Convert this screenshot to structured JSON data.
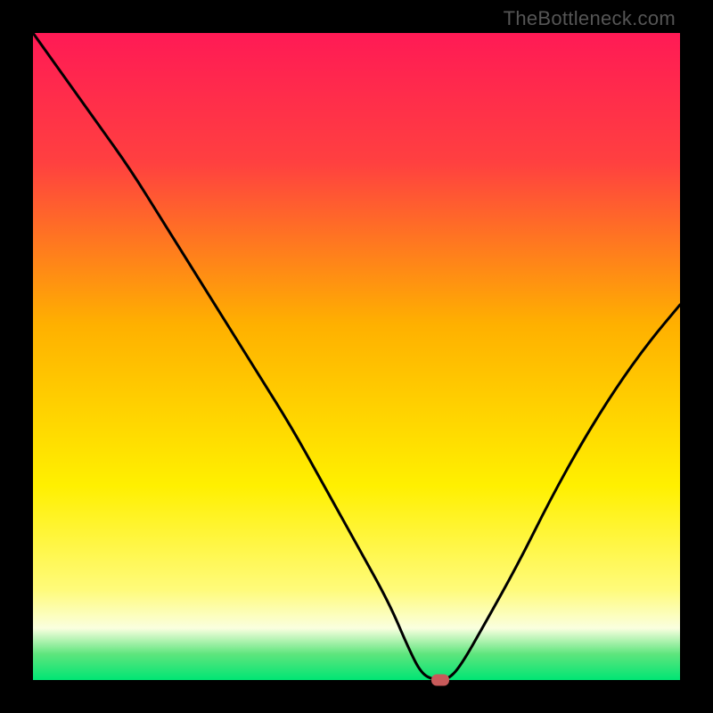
{
  "watermark": {
    "text": "TheBottleneck.com"
  },
  "colors": {
    "gradient_stops": [
      {
        "pct": 0,
        "color": "#ff1a55"
      },
      {
        "pct": 20,
        "color": "#ff4040"
      },
      {
        "pct": 45,
        "color": "#ffb000"
      },
      {
        "pct": 70,
        "color": "#fff000"
      },
      {
        "pct": 86,
        "color": "#fffb7a"
      },
      {
        "pct": 92,
        "color": "#faffdf"
      },
      {
        "pct": 96,
        "color": "#5ee57d"
      },
      {
        "pct": 100,
        "color": "#00e574"
      }
    ],
    "curve": "#000000",
    "marker": "#c85a5a"
  },
  "chart_data": {
    "type": "line",
    "title": "",
    "xlabel": "",
    "ylabel": "",
    "xlim": [
      0,
      100
    ],
    "ylim": [
      0,
      100
    ],
    "x": [
      0,
      5,
      10,
      15,
      20,
      25,
      30,
      35,
      40,
      45,
      50,
      55,
      58,
      60,
      62,
      64,
      66,
      70,
      75,
      80,
      85,
      90,
      95,
      100
    ],
    "values": [
      100,
      93,
      86,
      79,
      71,
      63,
      55,
      47,
      39,
      30,
      21,
      12,
      5,
      1,
      0,
      0,
      2,
      9,
      18,
      28,
      37,
      45,
      52,
      58
    ],
    "marker": {
      "x": 63,
      "y": 0
    }
  }
}
